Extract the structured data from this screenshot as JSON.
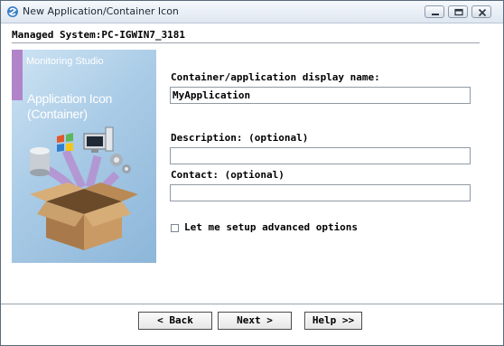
{
  "window": {
    "title": "New Application/Container Icon",
    "controls": [
      "minimize-icon",
      "maximize-icon",
      "close-icon"
    ]
  },
  "header": {
    "managed_system": "Managed System:PC-IGWIN7_3181"
  },
  "banner": {
    "product": "Monitoring Studio",
    "title_line1": "Application Icon",
    "title_line2": "(Container)",
    "accent_color": "#b184c9"
  },
  "form": {
    "name_label": "Container/application display name:",
    "name_value": "MyApplication",
    "description_label": "Description: (optional)",
    "description_value": "",
    "contact_label": "Contact: (optional)",
    "contact_value": "",
    "advanced_label": "Let me setup advanced options",
    "advanced_checked": false
  },
  "buttons": {
    "back": "< Back",
    "next": "Next >",
    "help": "Help >>"
  }
}
